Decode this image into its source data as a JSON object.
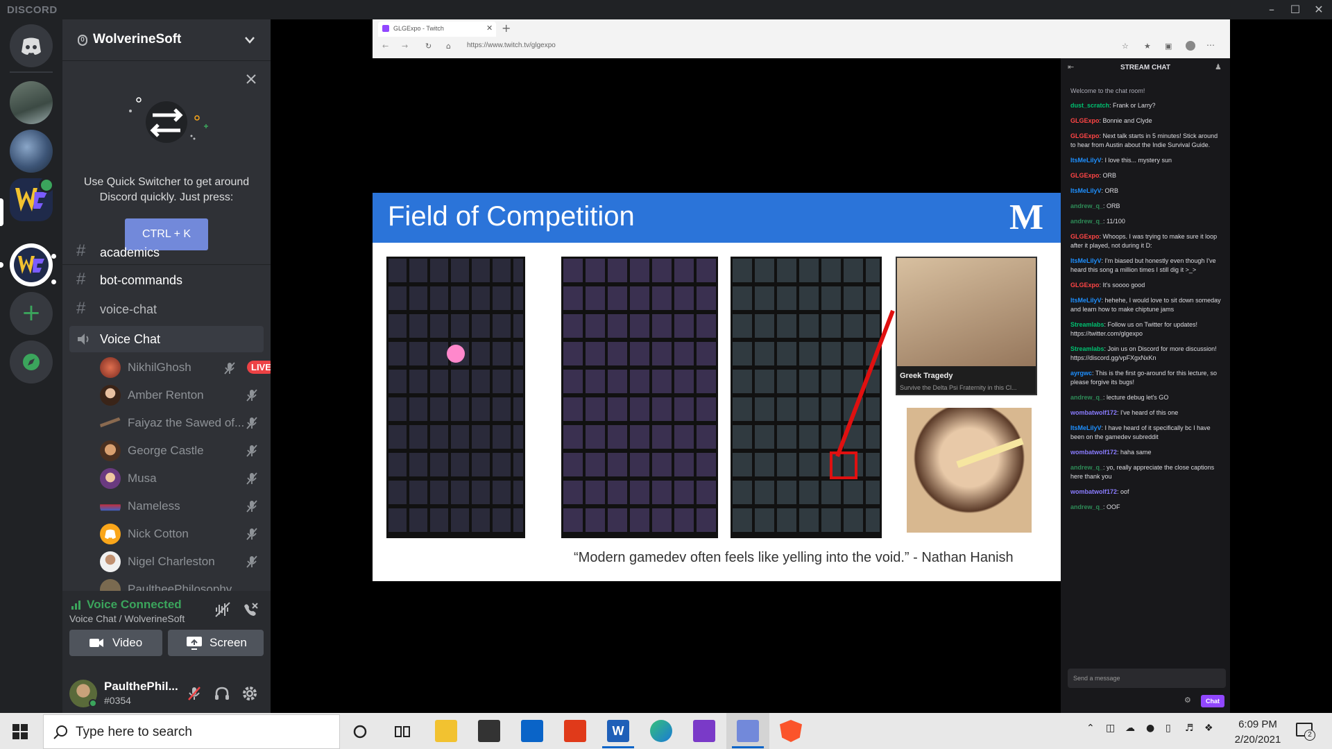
{
  "titlebar": {
    "brand": "DISCORD"
  },
  "server": {
    "name": "WolverineSoft",
    "boost_count": "0"
  },
  "quick_switcher": {
    "text": "Use Quick Switcher to get around Discord quickly. Just press:",
    "shortcut": "CTRL + K"
  },
  "channels": [
    {
      "name": "academics",
      "type": "text"
    },
    {
      "name": "bot-commands",
      "type": "text"
    },
    {
      "name": "voice-chat",
      "type": "text"
    },
    {
      "name": "Voice Chat",
      "type": "voice"
    }
  ],
  "voice_users": [
    {
      "name": "NikhilGhosh",
      "live": "LIVE"
    },
    {
      "name": "Amber Renton"
    },
    {
      "name": "Faiyaz the Sawed of..."
    },
    {
      "name": "George Castle"
    },
    {
      "name": "Musa"
    },
    {
      "name": "Nameless"
    },
    {
      "name": "Nick Cotton"
    },
    {
      "name": "Nigel Charleston"
    },
    {
      "name": "PaultheePhilosophy"
    }
  ],
  "voice_status": {
    "title": "Voice Connected",
    "location": "Voice Chat / WolverineSoft",
    "video_label": "Video",
    "screen_label": "Screen"
  },
  "user": {
    "name": "PaulthePhil...",
    "tag": "#0354"
  },
  "browser": {
    "tab_title": "GLGExpo - Twitch",
    "url": "https://www.twitch.tv/glgexpo"
  },
  "slide": {
    "title": "Field of Competition",
    "logo": "M",
    "game_title": "Greek Tragedy",
    "game_subtitle": "Survive the Delta Psi Fraternity in this Cl...",
    "quote": "“Modern gamedev often feels like yelling into the void.” - Nathan Hanish"
  },
  "stream_chat": {
    "header": "STREAM CHAT",
    "welcome": "Welcome to the chat room!",
    "messages": [
      {
        "user": "dust_scratch",
        "color": "#00c070",
        "text": "Frank or Larry?"
      },
      {
        "user": "GLGExpo",
        "color": "#ff4545",
        "text": "Bonnie and Clyde"
      },
      {
        "user": "GLGExpo",
        "color": "#ff4545",
        "text": "Next talk starts in 5 minutes! Stick around to hear from Austin about the Indie Survival Guide."
      },
      {
        "user": "ItsMeLilyV",
        "color": "#1e90ff",
        "text": "I love this... mystery sun"
      },
      {
        "user": "GLGExpo",
        "color": "#ff4545",
        "text": "ORB"
      },
      {
        "user": "ItsMeLilyV",
        "color": "#1e90ff",
        "text": "ORB"
      },
      {
        "user": "andrew_q_",
        "color": "#2e8b57",
        "text": "ORB"
      },
      {
        "user": "andrew_q_",
        "color": "#2e8b57",
        "text": "11/100"
      },
      {
        "user": "GLGExpo",
        "color": "#ff4545",
        "text": "Whoops. I was trying to make sure it loop after it played, not during it D:"
      },
      {
        "user": "ItsMeLilyV",
        "color": "#1e90ff",
        "text": "I'm biased but honestly even though I've heard this song a million times I still dig it >_>"
      },
      {
        "user": "GLGExpo",
        "color": "#ff4545",
        "text": "It's soooo good"
      },
      {
        "user": "ItsMeLilyV",
        "color": "#1e90ff",
        "text": "hehehe, I would love to sit down someday and learn how to make chiptune jams"
      },
      {
        "user": "Streamlabs",
        "color": "#00c070",
        "text": "Follow us on Twitter for updates! https://twitter.com/glgexpo"
      },
      {
        "user": "Streamlabs",
        "color": "#00c070",
        "text": "Join us on Discord for more discussion! https://discord.gg/vpFXgxNxKn"
      },
      {
        "user": "ayrgwc",
        "color": "#1e90ff",
        "text": "This is the first go-around for this lecture, so please forgive its bugs!"
      },
      {
        "user": "andrew_q_",
        "color": "#2e8b57",
        "text": "lecture debug let's GO"
      },
      {
        "user": "wombatwolf172",
        "color": "#8a7cff",
        "text": "I've heard of this one"
      },
      {
        "user": "ItsMeLilyV",
        "color": "#1e90ff",
        "text": "I have heard of it specifically bc I have been on the gamedev subreddit"
      },
      {
        "user": "wombatwolf172",
        "color": "#8a7cff",
        "text": "haha same"
      },
      {
        "user": "andrew_q_",
        "color": "#2e8b57",
        "text": "yo, really appreciate the close captions here thank you"
      },
      {
        "user": "wombatwolf172",
        "color": "#8a7cff",
        "text": "oof"
      },
      {
        "user": "andrew_q_",
        "color": "#2e8b57",
        "text": "OOF"
      }
    ],
    "input_placeholder": "Send a message",
    "send_label": "Chat"
  },
  "taskbar": {
    "search_placeholder": "Type here to search",
    "time": "6:09 PM",
    "date": "2/20/2021",
    "notification_count": "2"
  },
  "colors": {
    "blurple": "#7289da",
    "green": "#3ba55c",
    "live_red": "#ed4245"
  }
}
